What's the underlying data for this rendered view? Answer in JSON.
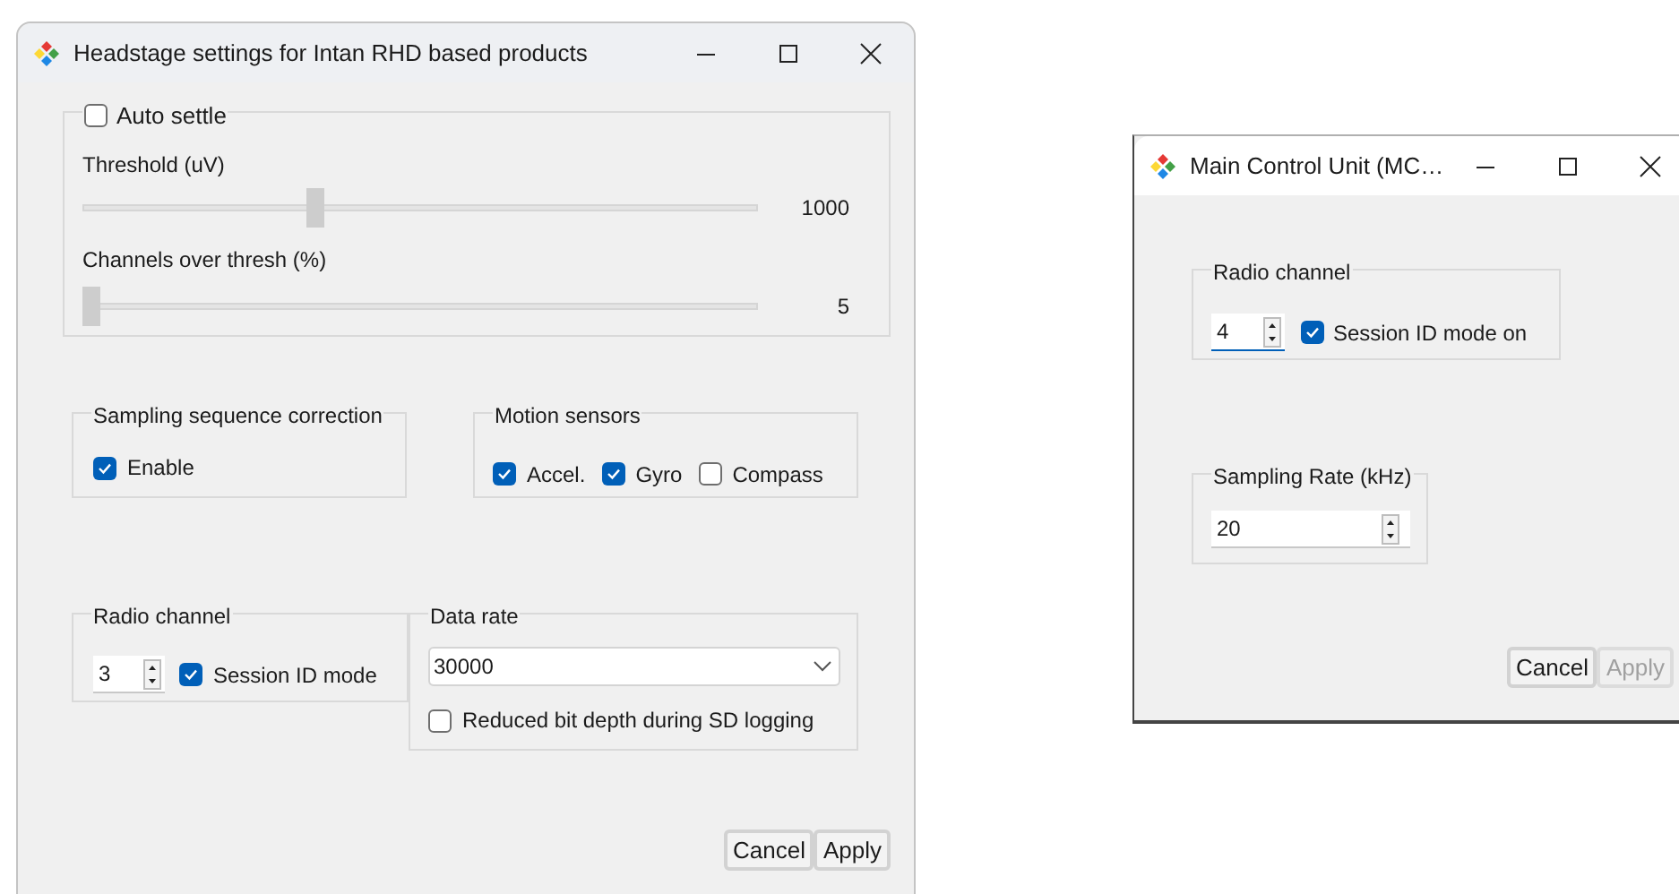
{
  "headstage_window": {
    "title": "Headstage settings for Intan RHD based products",
    "auto_settle": {
      "label": "Auto settle",
      "checked": false,
      "sliders": [
        {
          "label": "Threshold (uV)",
          "level": 0.34,
          "reading": "1000"
        },
        {
          "label": "Channels over thresh (%)",
          "level": 0,
          "reading": "5"
        }
      ]
    },
    "sampling_sequence_correction": {
      "title": "Sampling sequence correction",
      "checkboxes": [
        {
          "label": "Enable",
          "checked": true
        }
      ]
    },
    "motion_sensors": {
      "title": "Motion sensors",
      "checkboxes": [
        {
          "label": "Accel.",
          "checked": true
        },
        {
          "label": "Gyro",
          "checked": true
        },
        {
          "label": "Compass",
          "checked": false
        }
      ]
    },
    "radio_channel": {
      "title": "Radio channel",
      "value": "3",
      "session_id": {
        "label": "Session ID mode",
        "checked": true
      }
    },
    "data_rate": {
      "title": "Data rate",
      "value": "30000",
      "reduced_bit_depth": {
        "label": "Reduced bit depth during SD logging",
        "checked": false
      }
    },
    "buttons": [
      {
        "label": "Cancel",
        "disabled": false
      },
      {
        "label": "Apply",
        "disabled": false
      }
    ]
  },
  "mcu_window": {
    "title": "Main Control Unit (MC…",
    "radio_channel": {
      "title": "Radio channel",
      "value": "4",
      "session_id": {
        "label": "Session ID mode on",
        "checked": true
      }
    },
    "sampling_rate": {
      "title": "Sampling Rate (kHz)",
      "value": "20"
    },
    "buttons": [
      {
        "label": "Cancel",
        "disabled": false
      },
      {
        "label": "Apply",
        "disabled": true
      }
    ]
  }
}
